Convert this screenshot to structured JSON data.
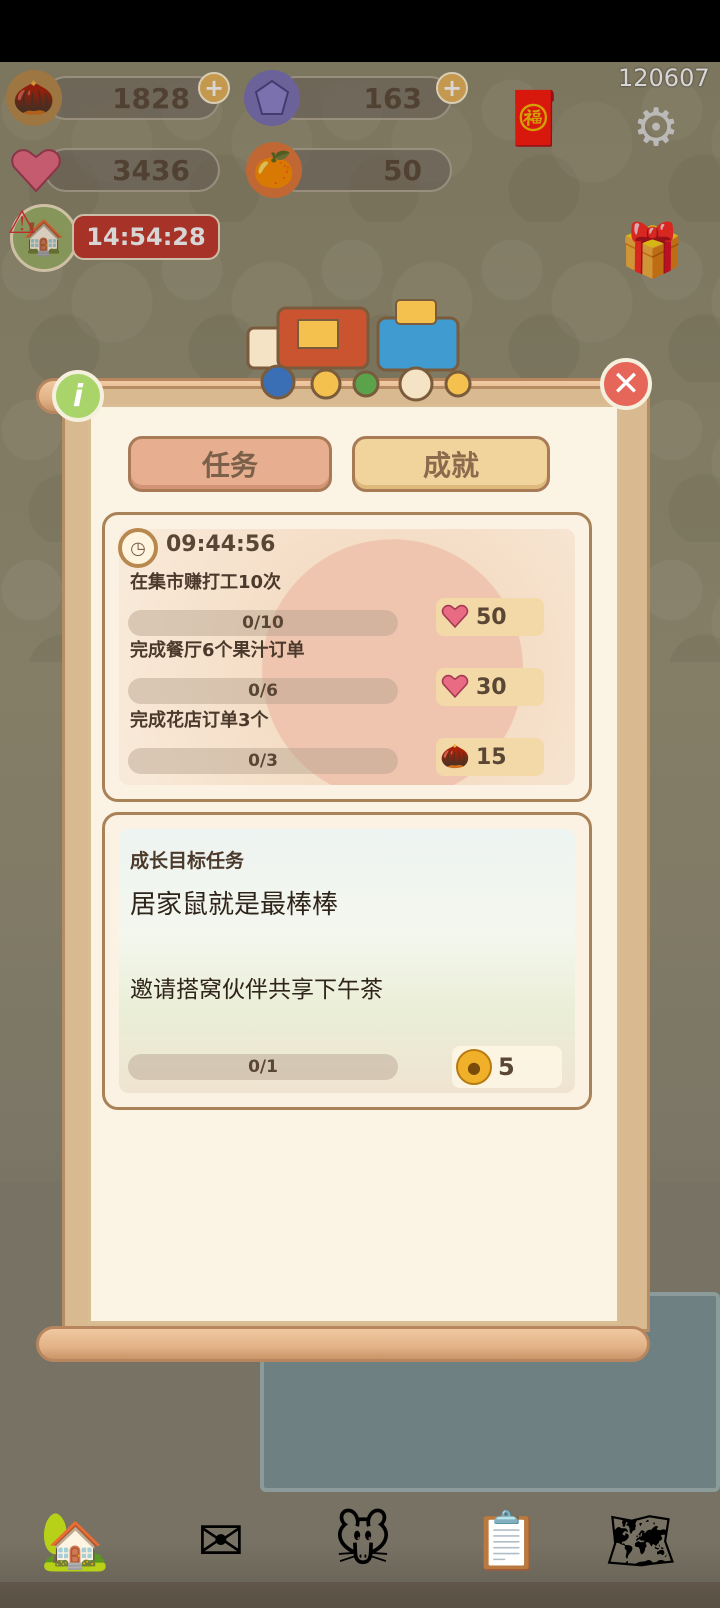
{
  "status": {
    "id_text": "120607"
  },
  "resources": {
    "acorns": {
      "value": "1828",
      "icon": "acorn-icon"
    },
    "gems": {
      "value": "163",
      "icon": "gem-icon"
    },
    "hearts": {
      "value": "3436",
      "icon": "heart-gem-icon"
    },
    "oranges": {
      "value": "50",
      "icon": "orange-icon"
    }
  },
  "event_timer": "14:54:28",
  "panel": {
    "tabs": [
      {
        "label": "任务",
        "active": true
      },
      {
        "label": "成就",
        "active": false
      }
    ],
    "daily": {
      "timer": "09:44:56",
      "tasks": [
        {
          "text": "在集市赚打工10次",
          "progress": "0/10",
          "reward_icon": "heart-gem-icon",
          "reward": "50"
        },
        {
          "text": "完成餐厅6个果汁订单",
          "progress": "0/6",
          "reward_icon": "heart-gem-icon",
          "reward": "30"
        },
        {
          "text": "完成花店订单3个",
          "progress": "0/3",
          "reward_icon": "acorn-icon",
          "reward": "15"
        }
      ]
    },
    "growth": {
      "title": "成长目标任务",
      "headline": "居家鼠就是最棒棒",
      "description": "邀请搭窝伙伴共享下午茶",
      "progress": "0/1",
      "reward_icon": "bell-icon",
      "reward": "5"
    }
  },
  "colors": {
    "tab_active": "#e7ae90",
    "tab_inactive": "#f0d49c",
    "timer_red": "#c3372d",
    "close_red": "#e6675a",
    "info_green": "#a8d46a"
  }
}
